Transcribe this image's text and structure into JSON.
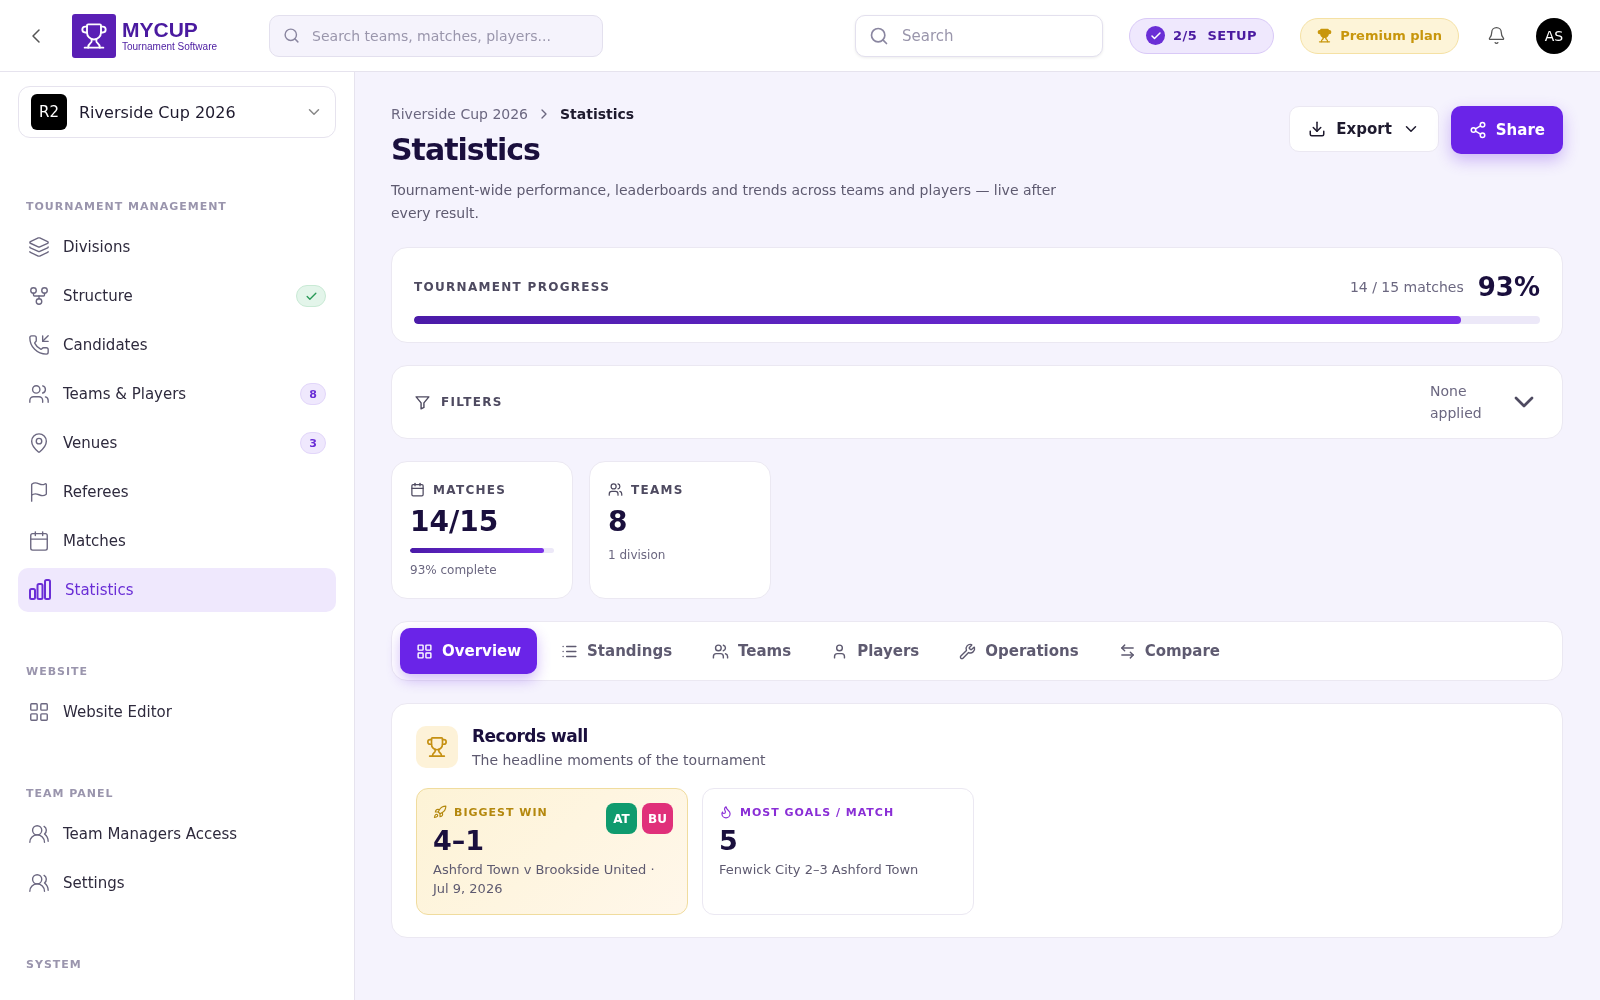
{
  "header": {
    "logo": {
      "title": "MYCUP",
      "subtitle": "Tournament Software"
    },
    "global_search": {
      "placeholder": "Search teams, matches, players..."
    },
    "search": {
      "placeholder": "Search"
    },
    "setup_badge": "2/5  SETUP",
    "plan_badge": "Premium plan",
    "avatar": "AS"
  },
  "sidebar": {
    "tournament": {
      "code": "R2",
      "name": "Riverside Cup 2026"
    },
    "sections": [
      {
        "title": "TOURNAMENT MANAGEMENT",
        "items": [
          {
            "label": "Divisions",
            "selected": false
          },
          {
            "label": "Structure",
            "selected": false,
            "badge": {
              "kind": "check"
            }
          },
          {
            "label": "Candidates",
            "selected": false
          },
          {
            "label": "Teams & Players",
            "selected": false,
            "badge": {
              "kind": "count",
              "text": "8"
            }
          },
          {
            "label": "Venues",
            "selected": false,
            "badge": {
              "kind": "count",
              "text": "3"
            }
          },
          {
            "label": "Referees",
            "selected": false
          },
          {
            "label": "Matches",
            "selected": false
          },
          {
            "label": "Statistics",
            "selected": true
          }
        ]
      },
      {
        "title": "WEBSITE",
        "items": [
          {
            "label": "Website Editor",
            "selected": false
          }
        ]
      },
      {
        "title": "TEAM PANEL",
        "items": [
          {
            "label": "Team Managers Access",
            "selected": false
          },
          {
            "label": "Settings",
            "selected": false
          }
        ]
      },
      {
        "title": "SYSTEM"
      }
    ]
  },
  "breadcrumb": [
    "Riverside Cup 2026",
    "Statistics"
  ],
  "page": {
    "title": "Statistics",
    "description": "Tournament-wide performance, leaderboards and trends across teams and players — live after every result.",
    "actions": {
      "export": "Export",
      "share": "Share"
    }
  },
  "progress": {
    "label": "TOURNAMENT PROGRESS",
    "reading": "14 / 15 matches",
    "percent": "93%",
    "level": 0.93
  },
  "filters": {
    "label": "FILTERS",
    "status": "None applied"
  },
  "stat_cards": [
    {
      "kind": "progress",
      "label": "MATCHES",
      "value": "14/15",
      "level": 0.93,
      "note": "93% complete"
    },
    {
      "kind": "plain",
      "label": "TEAMS",
      "value": "8",
      "note": "1 division"
    }
  ],
  "tabs": [
    {
      "label": "Overview",
      "selected": true
    },
    {
      "label": "Standings",
      "selected": false
    },
    {
      "label": "Teams",
      "selected": false
    },
    {
      "label": "Players",
      "selected": false
    },
    {
      "label": "Operations",
      "selected": false
    },
    {
      "label": "Compare",
      "selected": false
    }
  ],
  "records": {
    "title": "Records wall",
    "subtitle": "The headline moments of the tournament",
    "cards": [
      {
        "label": "BIGGEST WIN",
        "highlight": true,
        "value": "4–1",
        "detail": "Ashford Town v Brookside United · Jul 9, 2026",
        "teams": [
          {
            "code": "AT",
            "color": "#0f9b6e"
          },
          {
            "code": "BU",
            "color": "#e0307a"
          }
        ]
      },
      {
        "label": "MOST GOALS / MATCH",
        "highlight": false,
        "value": "5",
        "detail": "Fenwick City 2–3 Ashford Town"
      }
    ]
  }
}
